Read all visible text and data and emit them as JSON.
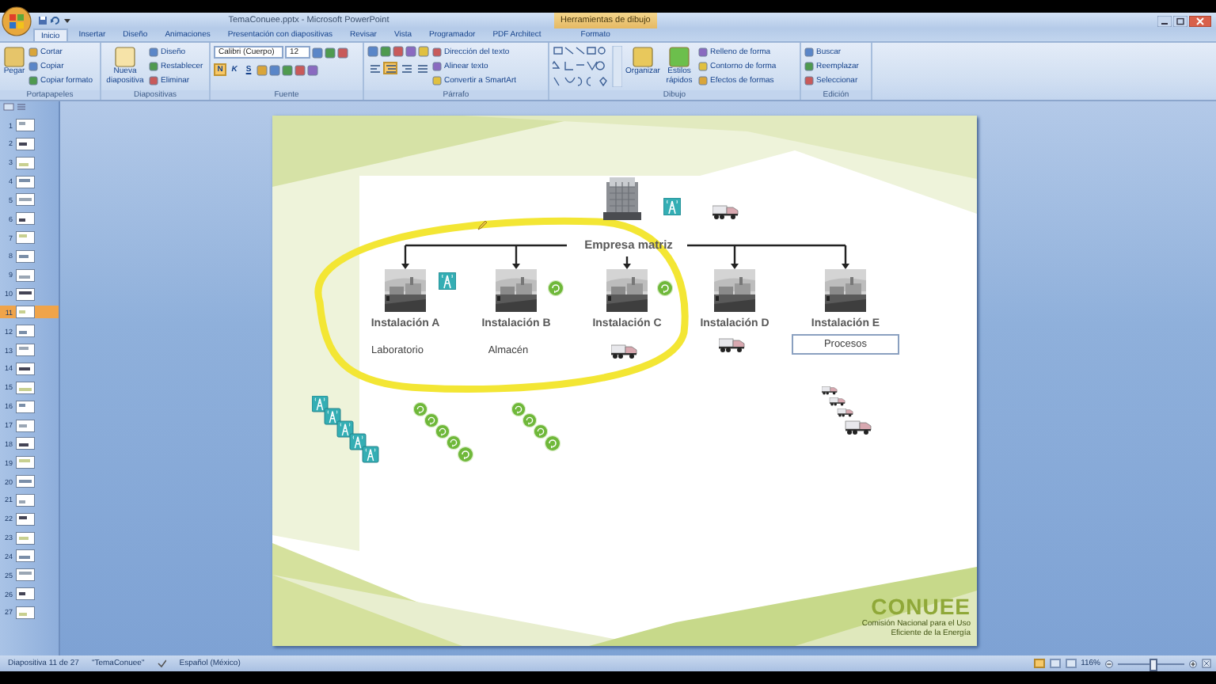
{
  "window": {
    "title": "TemaConuee.pptx - Microsoft PowerPoint",
    "context_tab": "Herramientas de dibujo"
  },
  "tabs": [
    {
      "label": "Inicio",
      "selected": true
    },
    {
      "label": "Insertar",
      "selected": false
    },
    {
      "label": "Diseño",
      "selected": false
    },
    {
      "label": "Animaciones",
      "selected": false
    },
    {
      "label": "Presentación con diapositivas",
      "selected": false
    },
    {
      "label": "Revisar",
      "selected": false
    },
    {
      "label": "Vista",
      "selected": false
    },
    {
      "label": "Programador",
      "selected": false
    },
    {
      "label": "PDF Architect",
      "selected": false
    },
    {
      "label": "Formato",
      "selected": false
    }
  ],
  "ribbon": [
    {
      "kind": "clipboard",
      "title": "Portapapeles",
      "big": [
        "Pegar"
      ],
      "small": [
        "Cortar",
        "Copiar",
        "Copiar formato"
      ]
    },
    {
      "kind": "slides",
      "title": "Diapositivas",
      "big": [
        "Nueva diapositiva"
      ],
      "small": [
        "Diseño",
        "Restablecer",
        "Eliminar"
      ]
    },
    {
      "kind": "font",
      "title": "Fuente",
      "font": "Calibri (Cuerpo)",
      "size": "12",
      "toggles": [
        {
          "label": "N",
          "on": true
        },
        {
          "label": "K",
          "on": false
        },
        {
          "label": "S",
          "on": false
        }
      ]
    },
    {
      "kind": "paragraph",
      "title": "Párrafo",
      "alignment": [
        {
          "selected": false
        },
        {
          "selected": true
        },
        {
          "selected": false
        },
        {
          "selected": false
        }
      ],
      "small": [
        "Dirección del texto",
        "Alinear texto",
        "Convertir a SmartArt"
      ]
    },
    {
      "kind": "drawing",
      "title": "Dibujo",
      "big": [
        "Organizar",
        "Estilos rápidos"
      ],
      "small": [
        "Relleno de forma",
        "Contorno de forma",
        "Efectos de formas"
      ]
    },
    {
      "kind": "editing",
      "title": "Edición",
      "small": [
        "Buscar",
        "Reemplazar",
        "Seleccionar"
      ]
    }
  ],
  "slides": [
    {
      "number": "1",
      "selected": false
    },
    {
      "number": "2",
      "selected": false
    },
    {
      "number": "3",
      "selected": false
    },
    {
      "number": "4",
      "selected": false
    },
    {
      "number": "5",
      "selected": false
    },
    {
      "number": "6",
      "selected": false
    },
    {
      "number": "7",
      "selected": false
    },
    {
      "number": "8",
      "selected": false
    },
    {
      "number": "9",
      "selected": false
    },
    {
      "number": "10",
      "selected": false
    },
    {
      "number": "11",
      "selected": true
    },
    {
      "number": "12",
      "selected": false
    },
    {
      "number": "13",
      "selected": false
    },
    {
      "number": "14",
      "selected": false
    },
    {
      "number": "15",
      "selected": false
    },
    {
      "number": "16",
      "selected": false
    },
    {
      "number": "17",
      "selected": false
    },
    {
      "number": "18",
      "selected": false
    },
    {
      "number": "19",
      "selected": false
    },
    {
      "number": "20",
      "selected": false
    },
    {
      "number": "21",
      "selected": false
    },
    {
      "number": "22",
      "selected": false
    },
    {
      "number": "23",
      "selected": false
    },
    {
      "number": "24",
      "selected": false
    },
    {
      "number": "25",
      "selected": false
    },
    {
      "number": "26",
      "selected": false
    },
    {
      "number": "27",
      "selected": false
    }
  ],
  "slide": {
    "org_chart": {
      "root": "Empresa matriz",
      "branches": [
        {
          "label": "Instalación A",
          "note": "Laboratorio",
          "selected": false
        },
        {
          "label": "Instalación B",
          "note": "Almacén",
          "selected": false
        },
        {
          "label": "Instalación C",
          "selected": false
        },
        {
          "label": "Instalación D",
          "selected": false
        },
        {
          "label": "Instalación E",
          "note": "Procesos",
          "selected": true
        }
      ]
    },
    "logo": {
      "name": "CONUEE",
      "tagline": "Comisión Nacional para el Uso Eficiente de la Energía"
    }
  },
  "status_bar": {
    "slide": "Diapositiva 11 de 27",
    "theme": "\"TemaConuee\"",
    "language": "Español (México)",
    "zoom": "116%",
    "zoom_slider": {
      "level": 0.5
    },
    "views": [
      {
        "selected": true
      },
      {
        "selected": false
      },
      {
        "selected": false
      }
    ]
  }
}
